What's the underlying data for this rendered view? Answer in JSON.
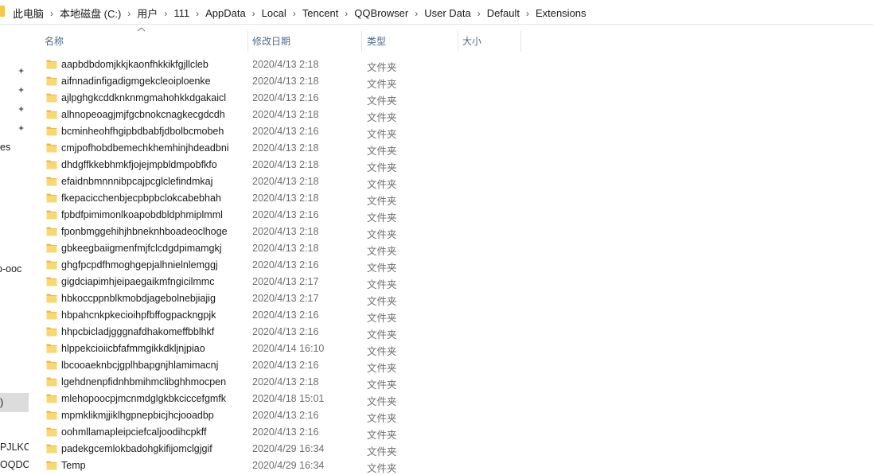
{
  "breadcrumb": [
    "此电脑",
    "本地磁盘 (C:)",
    "用户",
    "111",
    "AppData",
    "Local",
    "Tencent",
    "QQBrowser",
    "User Data",
    "Default",
    "Extensions"
  ],
  "columns": {
    "name": "名称",
    "modified": "修改日期",
    "type": "类型",
    "size": "大小"
  },
  "nav_fragments": [
    "es",
    "p-ooc",
    ")",
    "PJLKO",
    "OQDC"
  ],
  "files": [
    {
      "name": "aapbdbdomjkkjkaonfhkkikfgjllcleb",
      "modified": "2020/4/13 2:18",
      "type": "文件夹"
    },
    {
      "name": "aifnnadinfigadigmgekcleoiploenke",
      "modified": "2020/4/13 2:18",
      "type": "文件夹"
    },
    {
      "name": "ajlpghgkcddknknmgmahohkkdgakaicl",
      "modified": "2020/4/13 2:16",
      "type": "文件夹"
    },
    {
      "name": "alhnopeoagjmjfgcbnokcnagkecgdcdh",
      "modified": "2020/4/13 2:18",
      "type": "文件夹"
    },
    {
      "name": "bcminheohfhgipbdbabfjdbolbcmobeh",
      "modified": "2020/4/13 2:16",
      "type": "文件夹"
    },
    {
      "name": "cmjpofhobdbemechkhemhinjhdeadbni",
      "modified": "2020/4/13 2:18",
      "type": "文件夹"
    },
    {
      "name": "dhdgffkkebhmkfjojejmpbldmpobfkfo",
      "modified": "2020/4/13 2:18",
      "type": "文件夹"
    },
    {
      "name": "efaidnbmnnnibpcajpcglclefindmkaj",
      "modified": "2020/4/13 2:18",
      "type": "文件夹"
    },
    {
      "name": "fkepacicchenbjecpbpbclokcabebhah",
      "modified": "2020/4/13 2:18",
      "type": "文件夹"
    },
    {
      "name": "fpbdfpimimonlkoapobdbldphmiplmml",
      "modified": "2020/4/13 2:16",
      "type": "文件夹"
    },
    {
      "name": "fponbmggehihjhbneknhboadeoclhoge",
      "modified": "2020/4/13 2:18",
      "type": "文件夹"
    },
    {
      "name": "gbkeegbaiigmenfmjfclcdgdpimamgkj",
      "modified": "2020/4/13 2:18",
      "type": "文件夹"
    },
    {
      "name": "ghgfpcpdfhmoghgepjalhnielnlemggj",
      "modified": "2020/4/13 2:16",
      "type": "文件夹"
    },
    {
      "name": "gigdciapimhjeipaegaikmfngicilmmc",
      "modified": "2020/4/13 2:17",
      "type": "文件夹"
    },
    {
      "name": "hbkoccppnblkmobdjagebolnebjiajig",
      "modified": "2020/4/13 2:17",
      "type": "文件夹"
    },
    {
      "name": "hbpahcnkpkecioihpfbffogpackngpjk",
      "modified": "2020/4/13 2:16",
      "type": "文件夹"
    },
    {
      "name": "hhpcbicladjgggnafdhakomeffbblhkf",
      "modified": "2020/4/13 2:16",
      "type": "文件夹"
    },
    {
      "name": "hlppekcioiicbfafmmgikkdkljnjpiao",
      "modified": "2020/4/14 16:10",
      "type": "文件夹"
    },
    {
      "name": "lbcooaeknbcjgplhbapgnjhlamimacnj",
      "modified": "2020/4/13 2:16",
      "type": "文件夹"
    },
    {
      "name": "lgehdnenpfidnhbmihmclibghhmocpen",
      "modified": "2020/4/13 2:18",
      "type": "文件夹"
    },
    {
      "name": "mlehopoocpjmcnmdglgkbkciccefgmfk",
      "modified": "2020/4/18 15:01",
      "type": "文件夹"
    },
    {
      "name": "mpmklikmjjiklhgpnepbicjhcjooadbp",
      "modified": "2020/4/13 2:16",
      "type": "文件夹"
    },
    {
      "name": "oohmllamapleipciefcaljoodihcpkff",
      "modified": "2020/4/13 2:16",
      "type": "文件夹"
    },
    {
      "name": "padekgcemlokbadohgkifijomclgjgif",
      "modified": "2020/4/29 16:34",
      "type": "文件夹"
    },
    {
      "name": "Temp",
      "modified": "2020/4/29 16:34",
      "type": "文件夹"
    }
  ],
  "icons": {
    "folder": "folder-icon",
    "pin": "pin-icon",
    "sort": "sort-ascending-icon"
  },
  "colors": {
    "folder": "#f8d775",
    "header_text": "#4d6a8a",
    "meta_text": "#6d6d6d"
  }
}
